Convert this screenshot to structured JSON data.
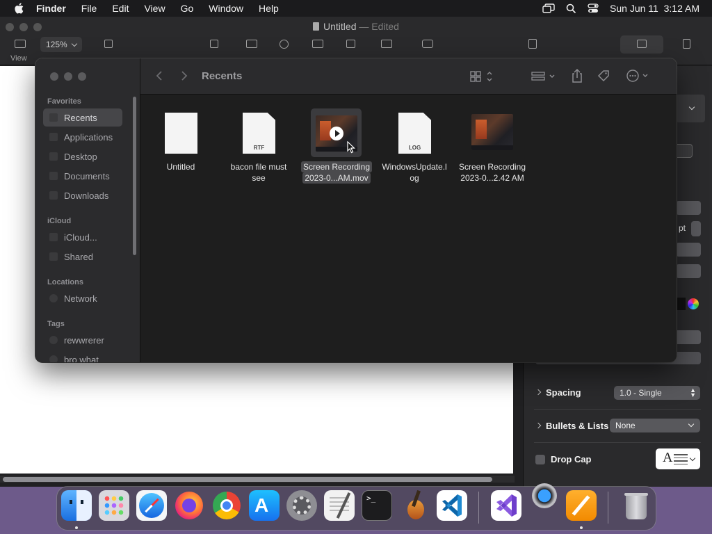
{
  "menubar": {
    "app_name": "Finder",
    "items": [
      "File",
      "Edit",
      "View",
      "Go",
      "Window",
      "Help"
    ],
    "clock": "Sun Jun 11  3:12 AM"
  },
  "pages": {
    "doc_title": "Untitled",
    "doc_status": "— Edited",
    "zoom": "125%",
    "toolbar_labels": {
      "view": "View"
    }
  },
  "inspector": {
    "pt_unit": "pt",
    "spacing_label": "Spacing",
    "spacing_value": "1.0 - Single",
    "bullets_label": "Bullets & Lists",
    "bullets_value": "None",
    "dropcap_label": "Drop Cap"
  },
  "finder": {
    "title": "Recents",
    "sidebar": {
      "favorites_header": "Favorites",
      "favorites": [
        "Recents",
        "Applications",
        "Desktop",
        "Documents",
        "Downloads"
      ],
      "icloud_header": "iCloud",
      "icloud": [
        "iCloud...",
        "Shared"
      ],
      "locations_header": "Locations",
      "locations": [
        "Network"
      ],
      "tags_header": "Tags",
      "tags": [
        "rewwrerer",
        "bro what"
      ]
    },
    "files": [
      {
        "line1": "Untitled",
        "line2": "",
        "ext": ""
      },
      {
        "line1": "bacon file must",
        "line2": "see",
        "ext": "RTF"
      },
      {
        "line1": "Screen Recording",
        "line2": "2023-0...AM.mov",
        "ext": ""
      },
      {
        "line1": "WindowsUpdate.l",
        "line2": "og",
        "ext": "LOG"
      },
      {
        "line1": "Screen Recording",
        "line2": "2023-0...2.42 AM",
        "ext": ""
      }
    ]
  },
  "colors": {
    "menubar_bg": "#1b1b1d",
    "finder_bg": "#1e1e1e",
    "sidebar_bg": "#2b2b2d",
    "selection": "#464649",
    "accent_orange": "#f5a623"
  },
  "icons": {
    "dock": [
      "finder-icon",
      "launchpad-icon",
      "safari-icon",
      "firefox-icon",
      "chrome-icon",
      "app-store-icon",
      "system-settings-icon",
      "textedit-icon",
      "terminal-icon",
      "garageband-icon",
      "vscode-icon",
      "visual-studio-icon",
      "pages-icon",
      "trash-icon"
    ]
  }
}
